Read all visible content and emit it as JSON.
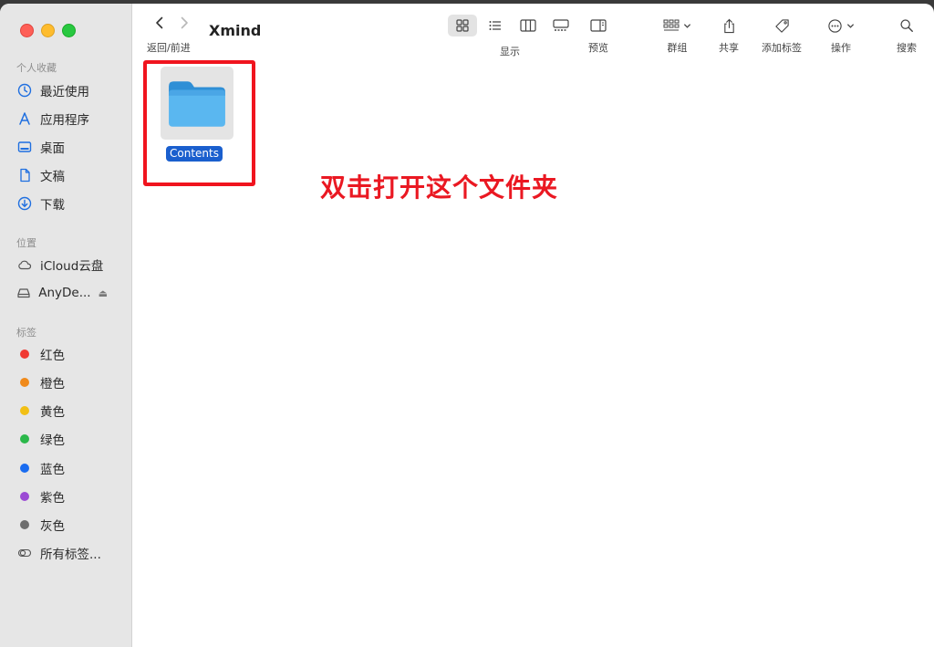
{
  "window": {
    "title": "Xmind"
  },
  "toolbar": {
    "nav_caption": "返回/前进",
    "view_label": "显示",
    "preview_label": "预览",
    "group_label": "群组",
    "share_label": "共享",
    "tag_label": "添加标签",
    "action_label": "操作",
    "search_label": "搜索"
  },
  "sidebar": {
    "favorites_title": "个人收藏",
    "favorites": [
      {
        "label": "最近使用",
        "icon": "clock-icon"
      },
      {
        "label": "应用程序",
        "icon": "applications-icon"
      },
      {
        "label": "桌面",
        "icon": "desktop-icon"
      },
      {
        "label": "文稿",
        "icon": "document-icon"
      },
      {
        "label": "下载",
        "icon": "download-icon"
      }
    ],
    "locations_title": "位置",
    "locations": [
      {
        "label": "iCloud云盘",
        "icon": "cloud-icon"
      },
      {
        "label": "AnyDe...",
        "icon": "drive-icon"
      }
    ],
    "tags_title": "标签",
    "tags": [
      {
        "label": "红色",
        "color": "#f03a33"
      },
      {
        "label": "橙色",
        "color": "#f08a1b"
      },
      {
        "label": "黄色",
        "color": "#f2c015"
      },
      {
        "label": "绿色",
        "color": "#2bb84a"
      },
      {
        "label": "蓝色",
        "color": "#1a6cf0"
      },
      {
        "label": "紫色",
        "color": "#9b4ad4"
      },
      {
        "label": "灰色",
        "color": "#6e6e6e"
      }
    ],
    "all_tags": "所有标签..."
  },
  "content": {
    "folder_name": "Contents",
    "annotation": "双击打开这个文件夹"
  },
  "colors": {
    "highlight_border": "#f0141e",
    "selection_blue": "#1a5fce",
    "folder_blue": "#5ab7f0"
  }
}
